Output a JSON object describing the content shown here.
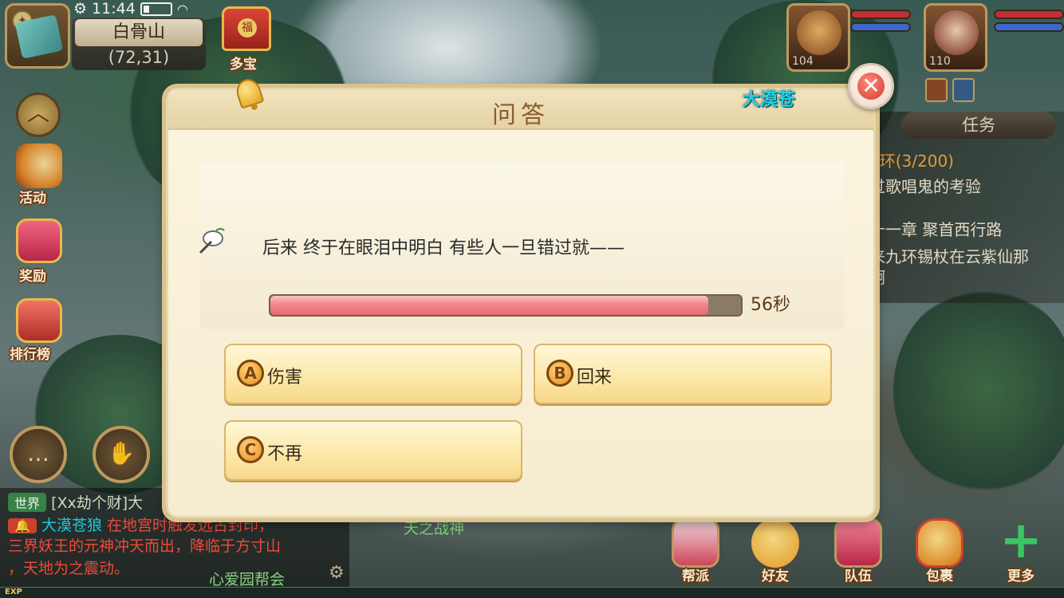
{
  "status_bar": {
    "time": "11:44"
  },
  "location": {
    "name": "白骨山",
    "coords": "(72,31)"
  },
  "hud": {
    "duobao_label": "多宝",
    "activity_label": "活动",
    "reward_label": "奖励",
    "ranking_label": "排行榜"
  },
  "party": [
    {
      "level": "104"
    },
    {
      "level": "110"
    }
  ],
  "quest": {
    "title": "任务",
    "lines": [
      "0环(3/200)",
      "过歌唱鬼的考验",
      "十一章  聚首西行路",
      "来九环锡杖在云紫仙那",
      "啊"
    ]
  },
  "chat": {
    "world_tag": "世界",
    "line1": "[Xx劫个财]大",
    "line2_name": "大漠苍狼",
    "line2_text": "在地宫时触发远古封印，",
    "line3": "三界妖王的元神冲天而出，降临于方寸山",
    "line4": "，天地为之震动。",
    "center_text": "天之战神",
    "footer_text": "心爱园帮会"
  },
  "exp_label": "EXP",
  "dock": [
    {
      "label": "帮派"
    },
    {
      "label": "好友"
    },
    {
      "label": "队伍"
    },
    {
      "label": "包裹"
    },
    {
      "label": "更多"
    }
  ],
  "dialog": {
    "title": "问答",
    "player_name": "大漠苍",
    "question": "后来 终于在眼泪中明白 有些人一旦错过就——",
    "timer_label": "56秒",
    "timer_fraction": 0.93,
    "options": [
      {
        "letter": "A",
        "text": "伤害"
      },
      {
        "letter": "B",
        "text": "回来"
      },
      {
        "letter": "C",
        "text": "不再"
      }
    ],
    "close_symbol": "✕"
  },
  "colors": {
    "dialog_bg": "#f6ecd0",
    "option_gold": "#fbe7a6",
    "timer_red": "#f0868a",
    "name_cyan": "#1fd3e6"
  }
}
